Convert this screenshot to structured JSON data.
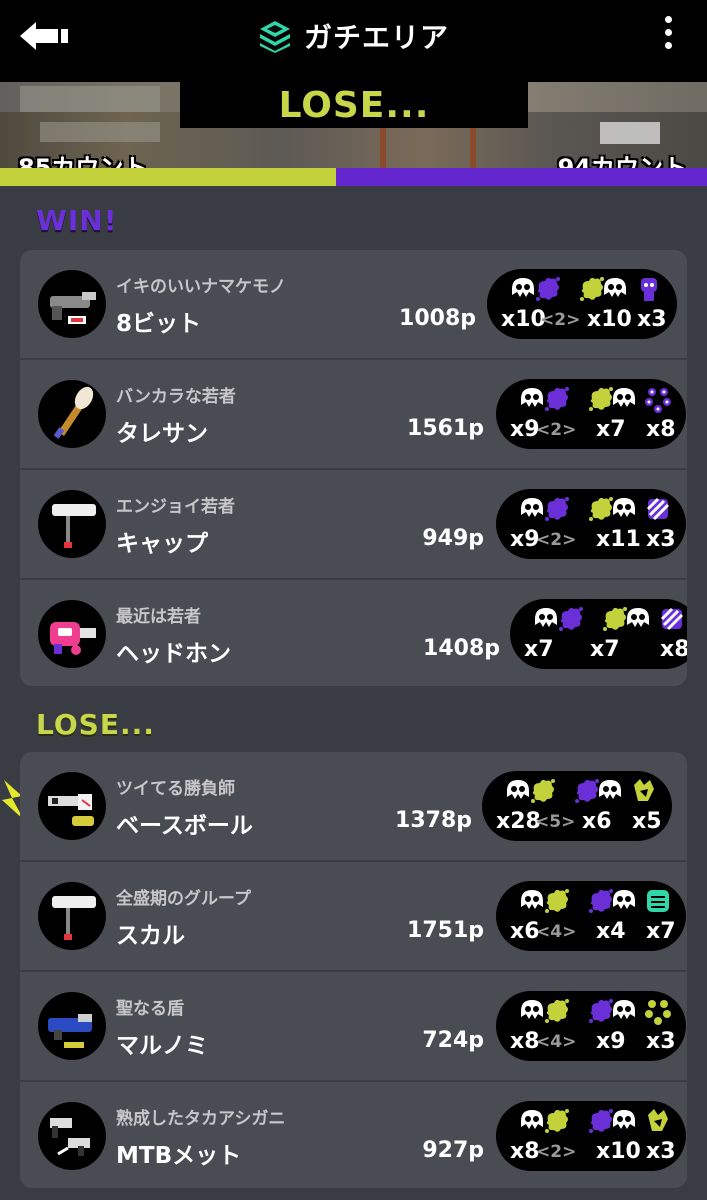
{
  "header": {
    "title": "ガチエリア"
  },
  "banner": {
    "result": "LOSE...",
    "left_count": "85カウント",
    "right_count": "94カウント"
  },
  "score_split": {
    "left_fraction": 0.475,
    "left_color": "#c3d23b",
    "right_color": "#6326cf"
  },
  "win_section": {
    "label": "WIN!",
    "players": [
      {
        "title": "イキのいいナマケモノ",
        "name": "8ビット",
        "points": "1008p",
        "kills": "x10",
        "assists": "<2>",
        "deaths": "x10",
        "specials": "x3",
        "weapon_icon": "splattershot-icon"
      },
      {
        "title": "バンカラな若者",
        "name": "タレサン",
        "points": "1561p",
        "kills": "x9",
        "assists": "<2>",
        "deaths": "x7",
        "specials": "x8",
        "weapon_icon": "brush-icon"
      },
      {
        "title": "エンジョイ若者",
        "name": "キャップ",
        "points": "949p",
        "kills": "x9",
        "assists": "<2>",
        "deaths": "x11",
        "specials": "x3",
        "weapon_icon": "roller-icon"
      },
      {
        "title": "最近は若者",
        "name": "ヘッドホン",
        "points": "1408p",
        "kills": "x7",
        "assists": "",
        "deaths": "x7",
        "specials": "x8",
        "weapon_icon": "blaster-icon"
      }
    ]
  },
  "lose_section": {
    "label": "LOSE...",
    "players": [
      {
        "title": "ツイてる勝負師",
        "name": "ベースボール",
        "points": "1378p",
        "kills": "x28",
        "assists": "<5>",
        "deaths": "x6",
        "specials": "x5",
        "weapon_icon": "charger-icon"
      },
      {
        "title": "全盛期のグループ",
        "name": "スカル",
        "points": "1751p",
        "kills": "x6",
        "assists": "<4>",
        "deaths": "x4",
        "specials": "x7",
        "weapon_icon": "roller-icon"
      },
      {
        "title": "聖なる盾",
        "name": "マルノミ",
        "points": "724p",
        "kills": "x8",
        "assists": "<4>",
        "deaths": "x9",
        "specials": "x3",
        "weapon_icon": "shooter-icon"
      },
      {
        "title": "熟成したタカアシガニ",
        "name": "MTBメット",
        "points": "927p",
        "kills": "x8",
        "assists": "<2>",
        "deaths": "x10",
        "specials": "x3",
        "weapon_icon": "dualies-icon"
      }
    ]
  }
}
